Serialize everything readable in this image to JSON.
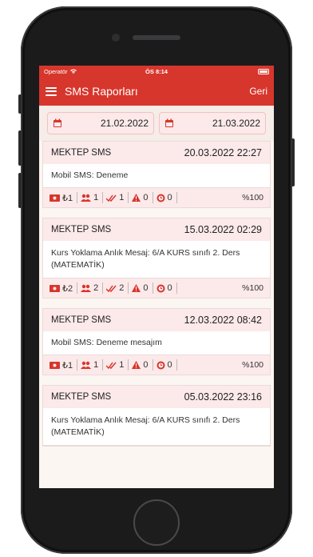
{
  "statusbar": {
    "carrier": "Operatör",
    "time": "ÖS 8:14"
  },
  "appbar": {
    "title": "SMS Raporları",
    "back_label": "Geri"
  },
  "filters": {
    "start_date": "21.02.2022",
    "end_date": "21.03.2022"
  },
  "reports": [
    {
      "source": "MEKTEP SMS",
      "datetime": "20.03.2022 22:27",
      "message": "Mobil SMS:  Deneme",
      "cost": "₺1",
      "recipients": "1",
      "delivered": "1",
      "failed": "0",
      "pending": "0",
      "rate": "%100"
    },
    {
      "source": "MEKTEP SMS",
      "datetime": "15.03.2022 02:29",
      "message": "Kurs Yoklama Anlık Mesaj: 6/A KURS sınıfı 2. Ders (MATEMATİK)",
      "cost": "₺2",
      "recipients": "2",
      "delivered": "2",
      "failed": "0",
      "pending": "0",
      "rate": "%100"
    },
    {
      "source": "MEKTEP SMS",
      "datetime": "12.03.2022 08:42",
      "message": "Mobil SMS:  Deneme mesajım",
      "cost": "₺1",
      "recipients": "1",
      "delivered": "1",
      "failed": "0",
      "pending": "0",
      "rate": "%100"
    },
    {
      "source": "MEKTEP SMS",
      "datetime": "05.03.2022 23:16",
      "message": "Kurs Yoklama Anlık Mesaj: 6/A KURS sınıfı 2. Ders (MATEMATİK)"
    }
  ],
  "colors": {
    "brand": "#d7362c",
    "header_bg": "#fce9ea"
  },
  "icons": {
    "menu": "hamburger-icon",
    "calendar": "calendar-icon",
    "cost": "money-icon",
    "recipients": "users-icon",
    "delivered": "double-check-icon",
    "failed": "warning-icon",
    "pending": "clock-icon"
  }
}
